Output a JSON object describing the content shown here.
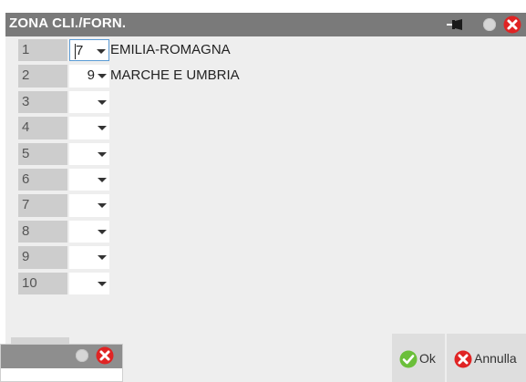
{
  "window": {
    "title": "ZONA CLI./FORN."
  },
  "rows": [
    {
      "num": "1",
      "code": "7",
      "desc": "EMILIA-ROMAGNA"
    },
    {
      "num": "2",
      "code": "9",
      "desc": "MARCHE E UMBRIA"
    },
    {
      "num": "3",
      "code": "",
      "desc": ""
    },
    {
      "num": "4",
      "code": "",
      "desc": ""
    },
    {
      "num": "5",
      "code": "",
      "desc": ""
    },
    {
      "num": "6",
      "code": "",
      "desc": ""
    },
    {
      "num": "7",
      "code": "",
      "desc": ""
    },
    {
      "num": "8",
      "code": "",
      "desc": ""
    },
    {
      "num": "9",
      "code": "",
      "desc": ""
    },
    {
      "num": "10",
      "code": "",
      "desc": ""
    }
  ],
  "buttons": {
    "ok": "Ok",
    "cancel": "Annulla"
  },
  "icons": {
    "title_bar": [
      "pin-icon",
      "dot-icon",
      "close-icon"
    ],
    "buttons": [
      "checkmark-icon",
      "close-icon"
    ]
  },
  "colors": {
    "title_bar": "#7a7a7a",
    "row_header": "#cdcdcd",
    "close_red": "#e02424",
    "ok_green": "#6bbf3a",
    "focus_border": "#5b9bd5"
  }
}
